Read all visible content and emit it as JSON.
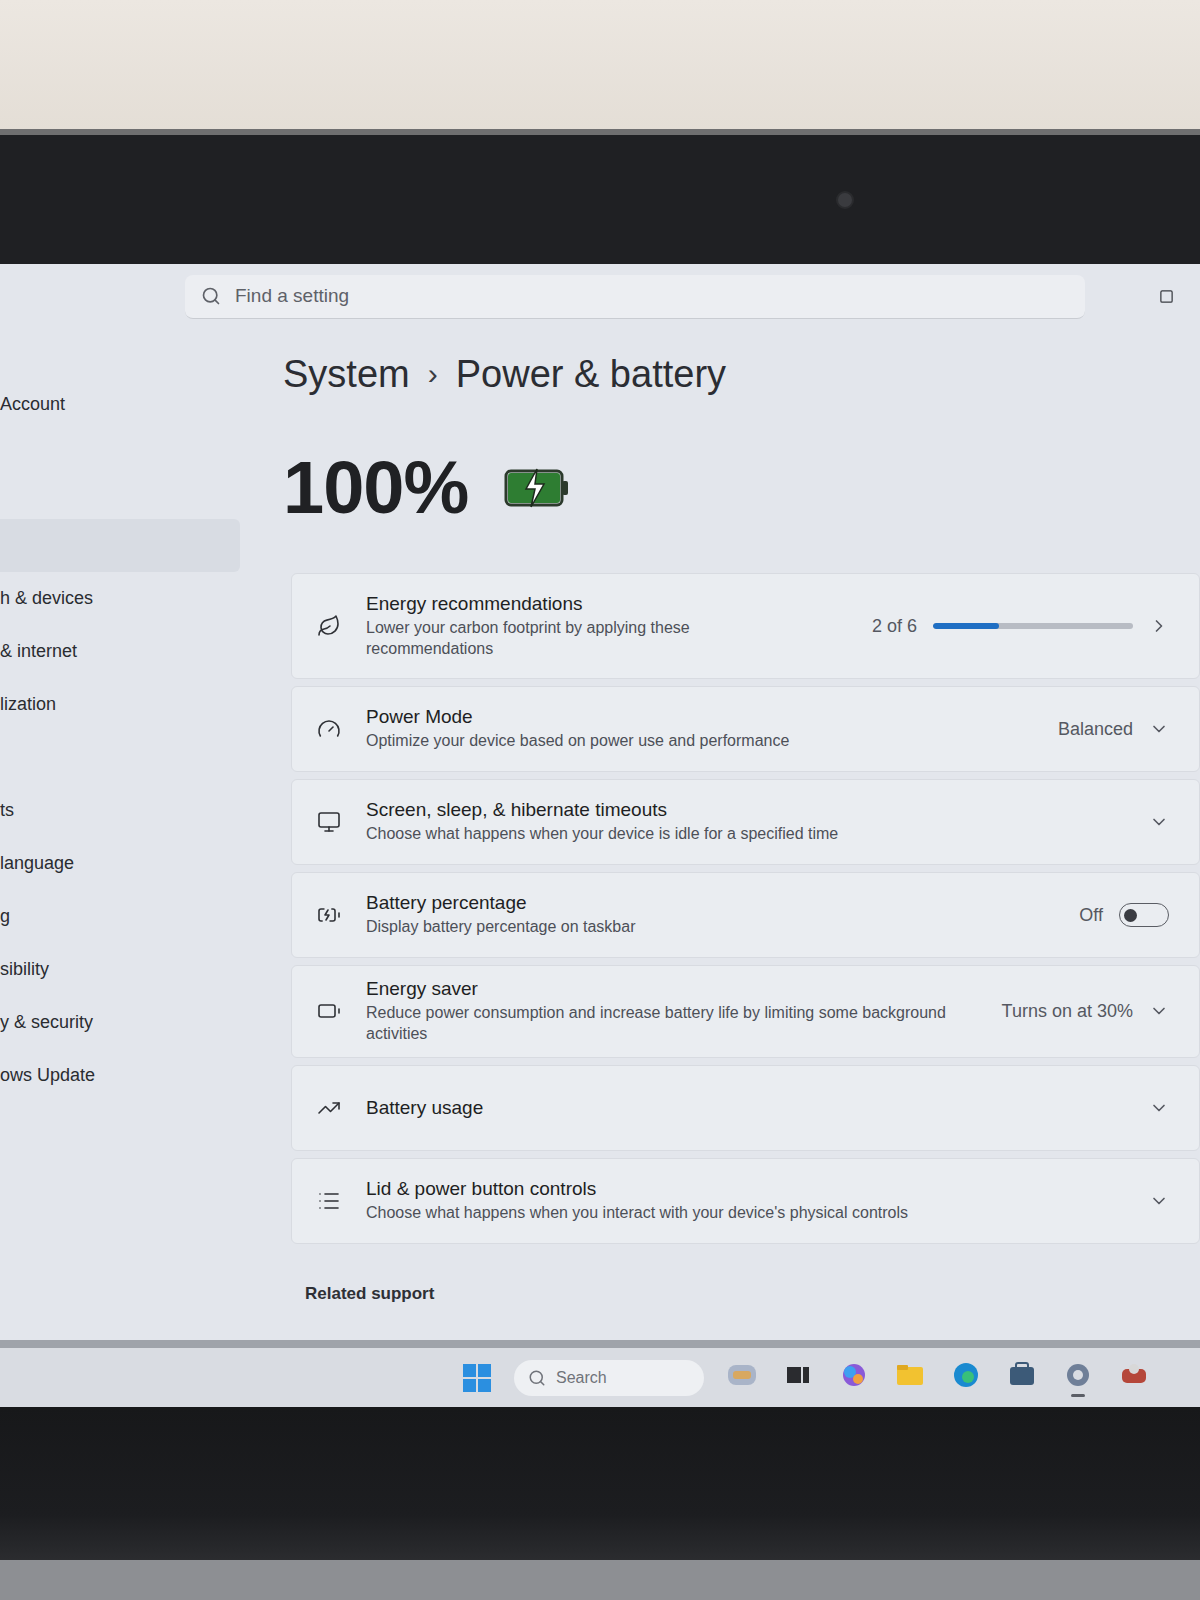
{
  "search": {
    "placeholder": "Find a setting"
  },
  "breadcrumb": {
    "parent": "System",
    "separator": "›",
    "current": "Power & battery"
  },
  "sidebar": {
    "items": [
      {
        "label": "Account",
        "selected": false
      },
      {
        "label": "",
        "selected": true
      },
      {
        "label": "h & devices",
        "selected": false
      },
      {
        "label": "& internet",
        "selected": false
      },
      {
        "label": "lization",
        "selected": false
      },
      {
        "label": "",
        "selected": false
      },
      {
        "label": "ts",
        "selected": false
      },
      {
        "label": "language",
        "selected": false
      },
      {
        "label": "g",
        "selected": false
      },
      {
        "label": "sibility",
        "selected": false
      },
      {
        "label": "y & security",
        "selected": false
      },
      {
        "label": "ows Update",
        "selected": false
      }
    ]
  },
  "battery": {
    "percent": "100%",
    "charging": true,
    "level": 1
  },
  "settings": [
    {
      "kind": "progress",
      "title": "Energy recommendations",
      "description": "Lower your carbon footprint by applying these recommendations",
      "value": "2 of 6",
      "level": 0.33
    },
    {
      "kind": "dropdown",
      "title": "Power Mode",
      "description": "Optimize your device based on power use and performance",
      "value": "Balanced"
    },
    {
      "kind": "expander",
      "title": "Screen, sleep, & hibernate timeouts",
      "description": "Choose what happens when your device is idle for a specified time"
    },
    {
      "kind": "toggle",
      "title": "Battery percentage",
      "description": "Display battery percentage on taskbar",
      "value": "Off",
      "on": false
    },
    {
      "kind": "dropdown",
      "title": "Energy saver",
      "description": "Reduce power consumption and increase battery life by limiting some background activities",
      "value": "Turns on at 30%"
    },
    {
      "kind": "expander",
      "title": "Battery usage",
      "description": ""
    },
    {
      "kind": "expander",
      "title": "Lid & power button controls",
      "description": "Choose what happens when you interact with your device's physical controls"
    }
  ],
  "related": {
    "title": "Related support"
  },
  "taskbar": {
    "search_placeholder": "Search"
  }
}
